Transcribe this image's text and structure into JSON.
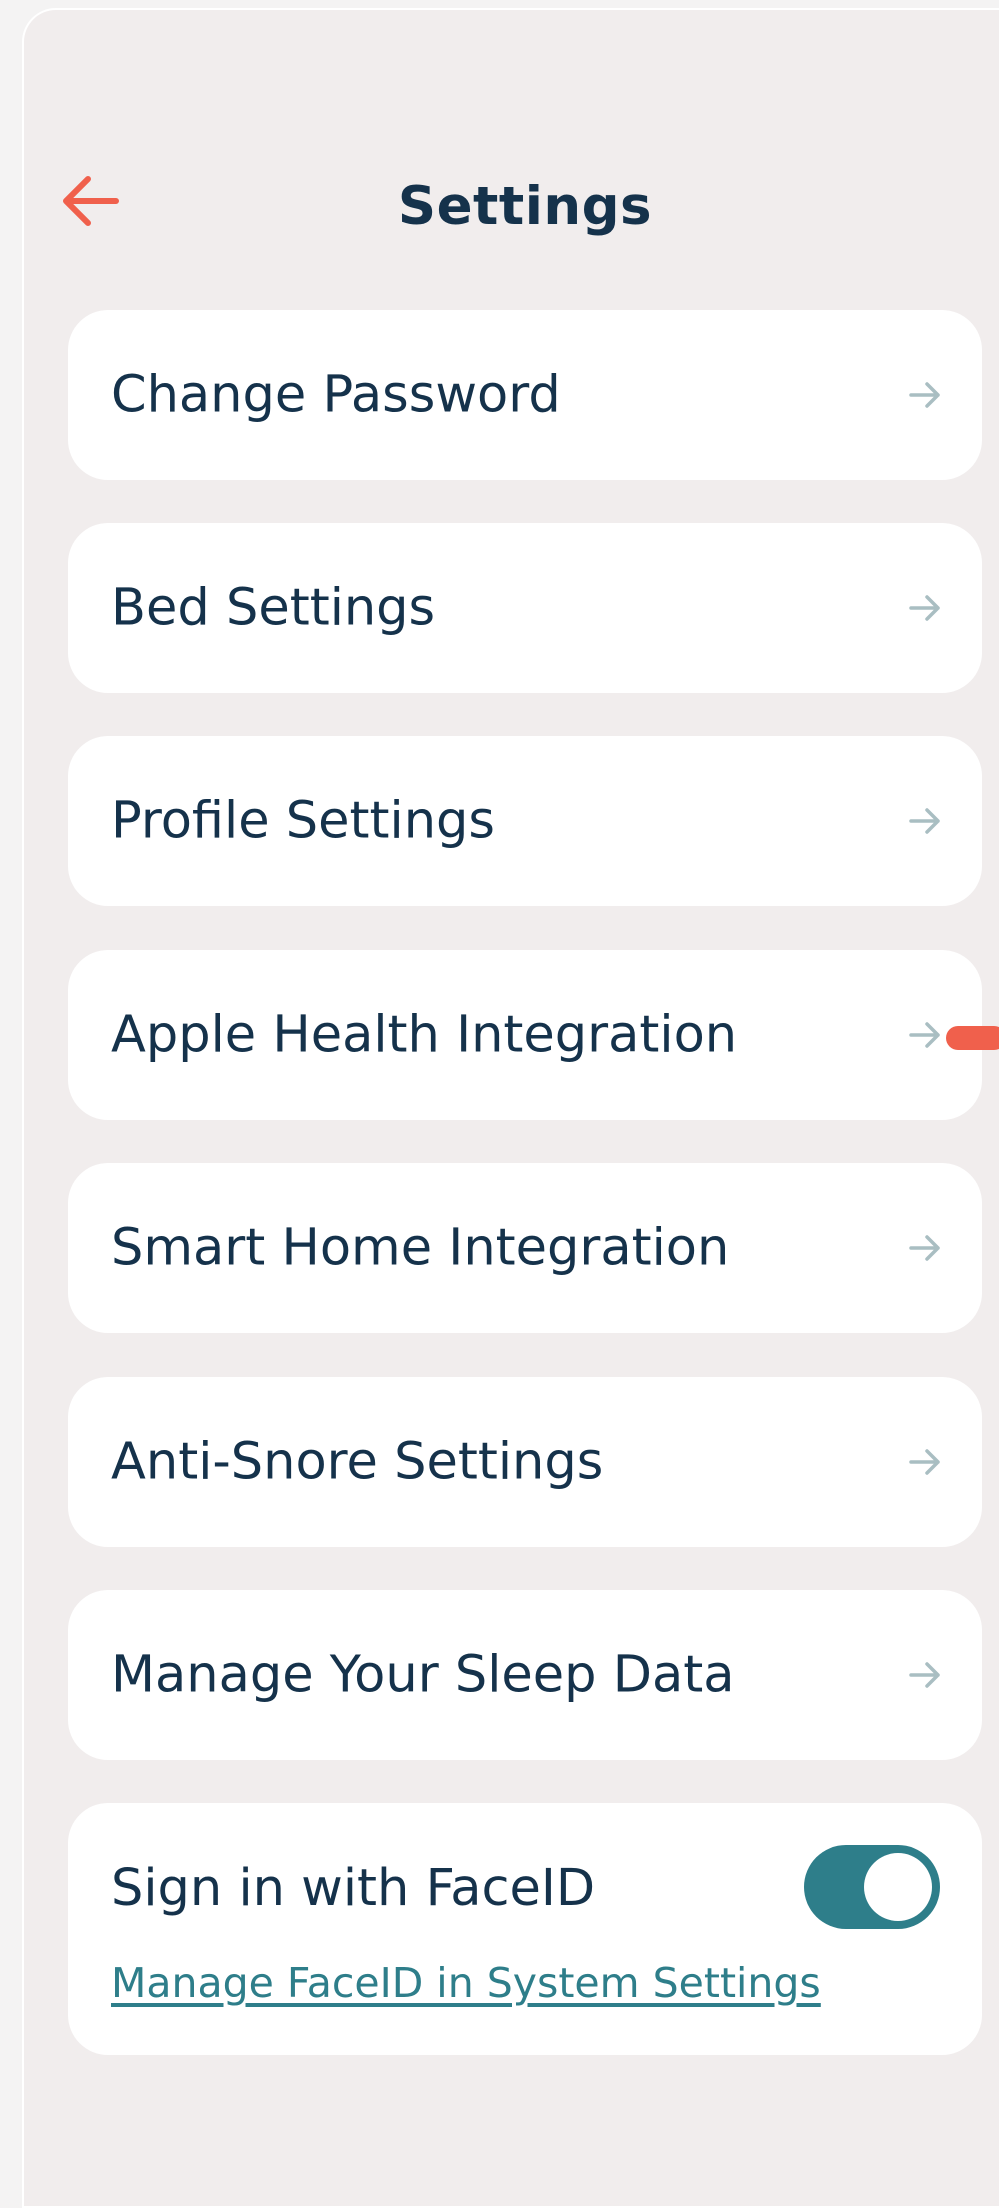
{
  "header": {
    "title": "Settings",
    "back_icon": "arrow-left-icon"
  },
  "menu": {
    "items": [
      {
        "label": "Change Password",
        "icon": "arrow-right-icon"
      },
      {
        "label": "Bed Settings",
        "icon": "arrow-right-icon"
      },
      {
        "label": "Profile Settings",
        "icon": "arrow-right-icon"
      },
      {
        "label": "Apple Health Integration",
        "icon": "arrow-right-icon"
      },
      {
        "label": "Smart Home Integration",
        "icon": "arrow-right-icon"
      },
      {
        "label": "Anti-Snore Settings",
        "icon": "arrow-right-icon"
      },
      {
        "label": "Manage Your Sleep Data",
        "icon": "arrow-right-icon"
      }
    ]
  },
  "faceid": {
    "label": "Sign in with FaceID",
    "enabled": true,
    "link_text": "Manage FaceID in System Settings"
  },
  "colors": {
    "accent": "#f0604c",
    "text": "#15324b",
    "toggle_on": "#2e7e8a",
    "background": "#f1eded",
    "card": "#ffffff",
    "arrow": "#a9bec2"
  }
}
